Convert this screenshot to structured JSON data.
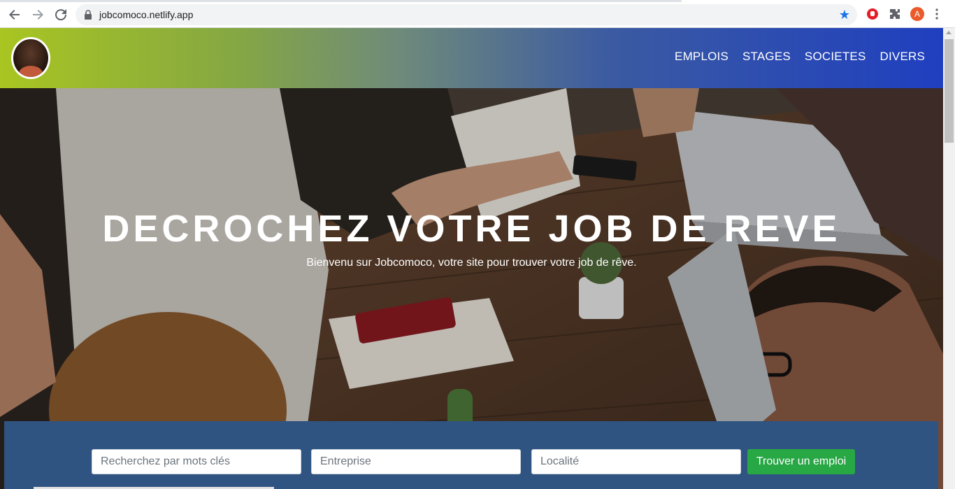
{
  "browser": {
    "url": "jobcomoco.netlify.app",
    "profile_initial": "A"
  },
  "navbar": {
    "links": [
      "EMPLOIS",
      "STAGES",
      "SOCIETES",
      "DIVERS"
    ]
  },
  "hero": {
    "title": "DECROCHEZ VOTRE JOB DE REVE",
    "subtitle": "Bienvenu sur Jobcomoco, votre site pour trouver votre job de rêve."
  },
  "search": {
    "keywords_placeholder": "Recherchez par mots clés",
    "company_placeholder": "Entreprise",
    "location_placeholder": "Localité",
    "submit_label": "Trouver un emploi"
  },
  "colors": {
    "nav_gradient_start": "#a9c521",
    "nav_gradient_end": "#1f3fc0",
    "search_band": "#2f5482",
    "button_green": "#28a745"
  }
}
